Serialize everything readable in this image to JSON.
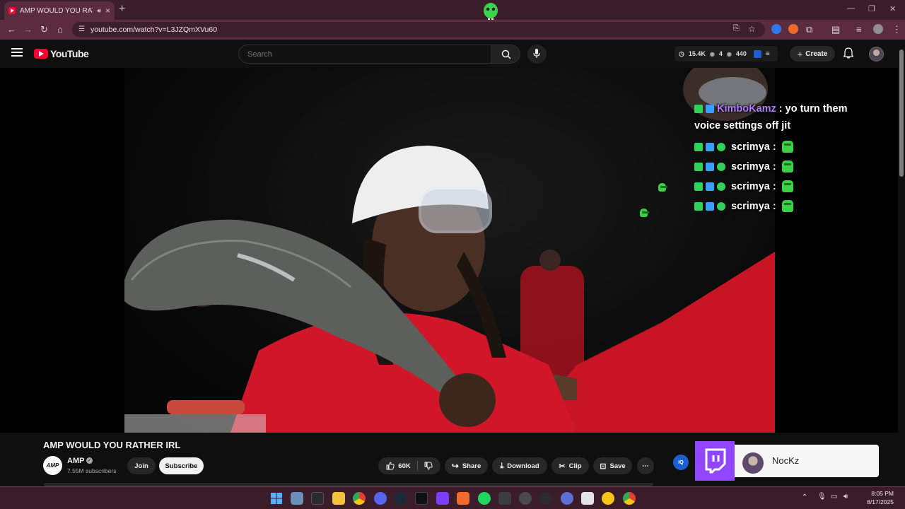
{
  "browser": {
    "tab_title": "AMP WOULD YOU RATHER",
    "url": "youtube.com/watch?v=L3JZQmXVu60"
  },
  "youtube": {
    "logo_text": "YouTube",
    "search_placeholder": "Search",
    "stats": {
      "views": "15.4K",
      "watching": "4",
      "viewers": "440"
    },
    "create_label": "Create"
  },
  "chat": {
    "messages": [
      {
        "user": "KimboKamz",
        "text": ": yo turn them",
        "cont": "voice settings off jit",
        "user_color": "#b27cff"
      },
      {
        "user": "scrimya",
        "text": ":",
        "user_color": "#ffffff"
      },
      {
        "user": "scrimya",
        "text": ":",
        "user_color": "#ffffff"
      },
      {
        "user": "scrimya",
        "text": ":",
        "user_color": "#ffffff"
      },
      {
        "user": "scrimya",
        "text": ":",
        "user_color": "#ffffff"
      }
    ]
  },
  "video": {
    "title": "AMP WOULD YOU RATHER IRL",
    "channel": {
      "name": "AMP",
      "avatar_text": "AMP",
      "subscribers": "7.55M subscribers",
      "join_label": "Join",
      "subscribe_label": "Subscribe"
    },
    "actions": {
      "likes": "60K",
      "share": "Share",
      "download": "Download",
      "clip": "Clip",
      "save": "Save",
      "more": "⋯"
    }
  },
  "twitch": {
    "streamer": "NocKz",
    "iq_label": "IQ"
  },
  "taskbar": {
    "time": "8:05 PM",
    "date": "8/17/2025"
  },
  "colors": {
    "browser_frame": "#5a2c3e",
    "youtube_red": "#ff0033",
    "twitch_purple": "#9146ff",
    "emote_green": "#3bd147"
  }
}
